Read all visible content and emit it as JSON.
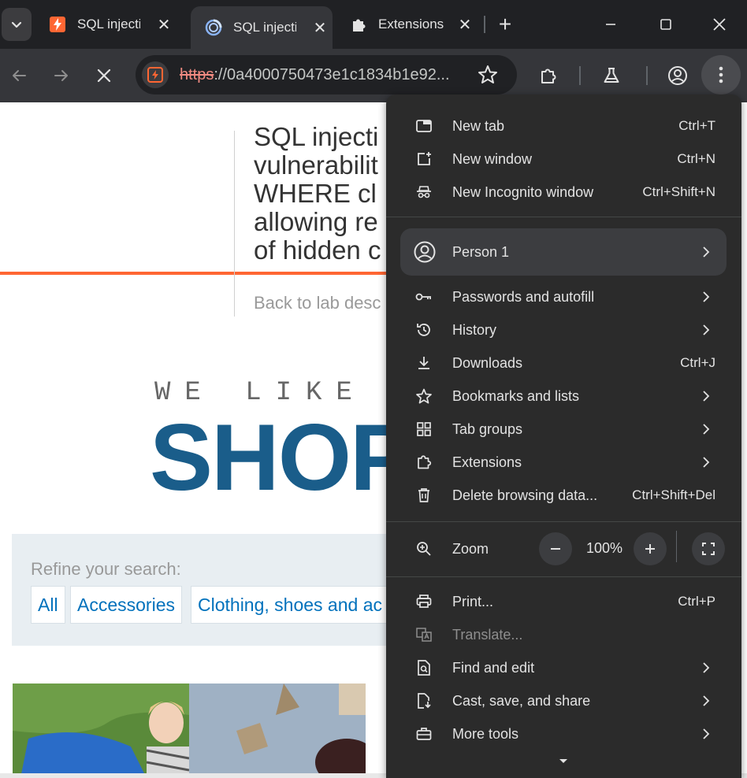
{
  "tabs": {
    "search_label": "",
    "items": [
      {
        "title": "SQL injecti",
        "active": false
      },
      {
        "title": "SQL injecti",
        "active": true
      },
      {
        "title": "Extensions",
        "active": false
      }
    ]
  },
  "omnibox": {
    "scheme": "https",
    "rest": "://0a4000750473e1c1834b1e92..."
  },
  "page": {
    "lab_title": "SQL injection vulnerability in WHERE clause allowing retrieval of hidden data",
    "lab_title_lines": [
      "SQL injecti",
      "vulnerabilit",
      "WHERE cl",
      "allowing re",
      "of hidden c"
    ],
    "back_link": "Back to lab desc",
    "tagline": "WE LIKE TO",
    "brand": "SHOP",
    "refine_label": "Refine your search:",
    "filters": [
      "All",
      "Accessories",
      "Clothing, shoes and ac"
    ]
  },
  "menu": {
    "items_top": [
      {
        "label": "New tab",
        "shortcut": "Ctrl+T",
        "icon": "new-tab-icon"
      },
      {
        "label": "New window",
        "shortcut": "Ctrl+N",
        "icon": "new-window-icon"
      },
      {
        "label": "New Incognito window",
        "shortcut": "Ctrl+Shift+N",
        "icon": "incognito-icon"
      }
    ],
    "person": "Person 1",
    "items_mid": [
      {
        "label": "Passwords and autofill",
        "shortcut": "",
        "icon": "key-icon",
        "submenu": true
      },
      {
        "label": "History",
        "shortcut": "",
        "icon": "history-icon",
        "submenu": true
      },
      {
        "label": "Downloads",
        "shortcut": "Ctrl+J",
        "icon": "download-icon",
        "submenu": false
      },
      {
        "label": "Bookmarks and lists",
        "shortcut": "",
        "icon": "star-icon",
        "submenu": true
      },
      {
        "label": "Tab groups",
        "shortcut": "",
        "icon": "tab-groups-icon",
        "submenu": true
      },
      {
        "label": "Extensions",
        "shortcut": "",
        "icon": "puzzle-icon",
        "submenu": true
      },
      {
        "label": "Delete browsing data...",
        "shortcut": "Ctrl+Shift+Del",
        "icon": "trash-icon",
        "submenu": false
      }
    ],
    "zoom": {
      "label": "Zoom",
      "value": "100%",
      "minus": "–",
      "plus": "+"
    },
    "items_bottom": [
      {
        "label": "Print...",
        "shortcut": "Ctrl+P",
        "icon": "print-icon",
        "submenu": false,
        "disabled": false
      },
      {
        "label": "Translate...",
        "shortcut": "",
        "icon": "translate-icon",
        "submenu": false,
        "disabled": true
      },
      {
        "label": "Find and edit",
        "shortcut": "",
        "icon": "find-icon",
        "submenu": true,
        "disabled": false
      },
      {
        "label": "Cast, save, and share",
        "shortcut": "",
        "icon": "cast-save-icon",
        "submenu": true,
        "disabled": false
      },
      {
        "label": "More tools",
        "shortcut": "",
        "icon": "toolbox-icon",
        "submenu": true,
        "disabled": false
      }
    ]
  },
  "colors": {
    "chrome_dark": "#202124",
    "toolbar": "#35363a",
    "menu_bg": "#2b2b2b",
    "brand_blue": "#1a5d8a",
    "accent_orange": "#ff6633",
    "link_blue": "#0071bc"
  }
}
